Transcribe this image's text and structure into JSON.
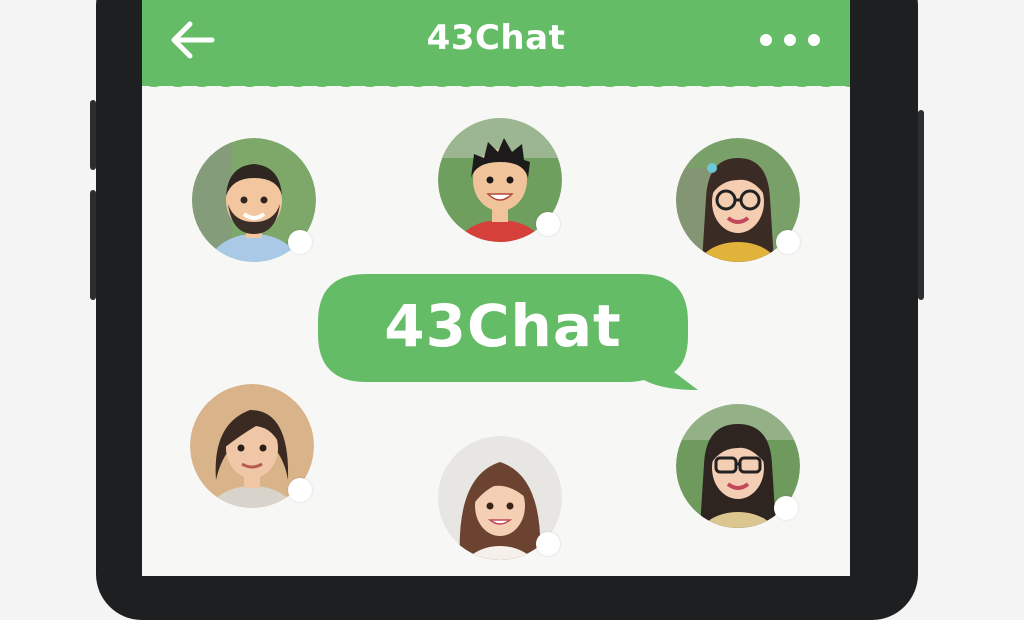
{
  "app": {
    "title": "43Chat"
  },
  "header": {
    "back_icon": "arrow-left-icon",
    "more_icon": "more-horizontal-icon",
    "color": "#64bc67"
  },
  "logo": {
    "text": "43Chat",
    "color": "#64bc67"
  },
  "contacts": [
    {
      "id": "man-beard",
      "skin": "#f2c7a0",
      "hair": "#2f2621",
      "shirt": "#a9c9e6",
      "bg": "#7ea86a"
    },
    {
      "id": "boy-spiky",
      "skin": "#f0c39b",
      "hair": "#1c1a1a",
      "shirt": "#d6403a",
      "bg": "#6f9f5f"
    },
    {
      "id": "woman-glasses-yellow",
      "skin": "#f5cdb0",
      "hair": "#3a2b25",
      "shirt": "#e2b33a",
      "bg": "#7aa06a"
    },
    {
      "id": "young-man-longhair",
      "skin": "#efc7a6",
      "hair": "#3a2a22",
      "shirt": "#d8d4cc",
      "bg": "#d9b48a"
    },
    {
      "id": "girl-brownhair",
      "skin": "#f4cfb3",
      "hair": "#6b4330",
      "shirt": "#f5f0ea",
      "bg": "#e8e6e2"
    },
    {
      "id": "woman-glasses-green",
      "skin": "#f3cdb4",
      "hair": "#2e2420",
      "shirt": "#dcc690",
      "bg": "#6f9a5e"
    }
  ]
}
